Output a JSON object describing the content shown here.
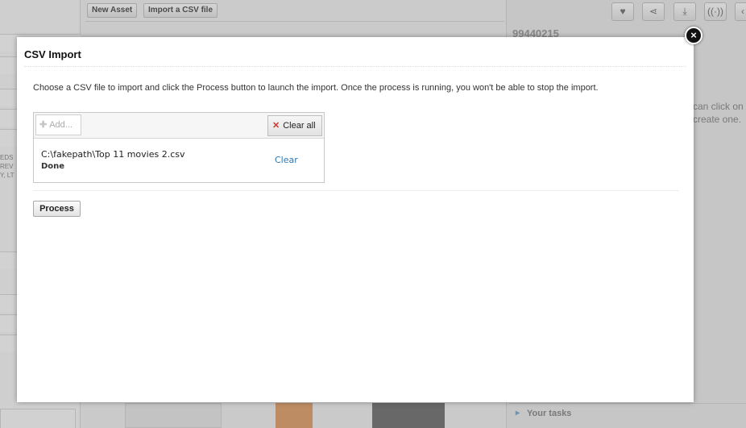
{
  "background": {
    "toolbar": {
      "new_asset": "New Asset",
      "import_csv": "Import a CSV file"
    },
    "asset_id": "99440215",
    "hint_lines": [
      "can click on",
      "create one."
    ],
    "left_fragments": [
      "EDS",
      "REV",
      "Y, LT"
    ],
    "tasks_label": "Your tasks",
    "icons": [
      "heart-icon",
      "share-icon",
      "download-icon",
      "broadcast-icon"
    ]
  },
  "modal": {
    "title": "CSV Import",
    "close_label": "×",
    "intro": "Choose a CSV file to import and click the Process button to launch the import. Once the process is running, you won't be able to stop the import.",
    "uploader": {
      "add_label": "Add...",
      "clear_all_label": "Clear all",
      "files": [
        {
          "name": "C:\\fakepath\\Top 11 movies 2.csv",
          "status": "Done",
          "clear_label": "Clear"
        }
      ]
    },
    "process_label": "Process"
  },
  "colors": {
    "link": "#2a7ab8",
    "clear_x": "#d0342c",
    "overlay_bg": "#d2d2d2"
  }
}
